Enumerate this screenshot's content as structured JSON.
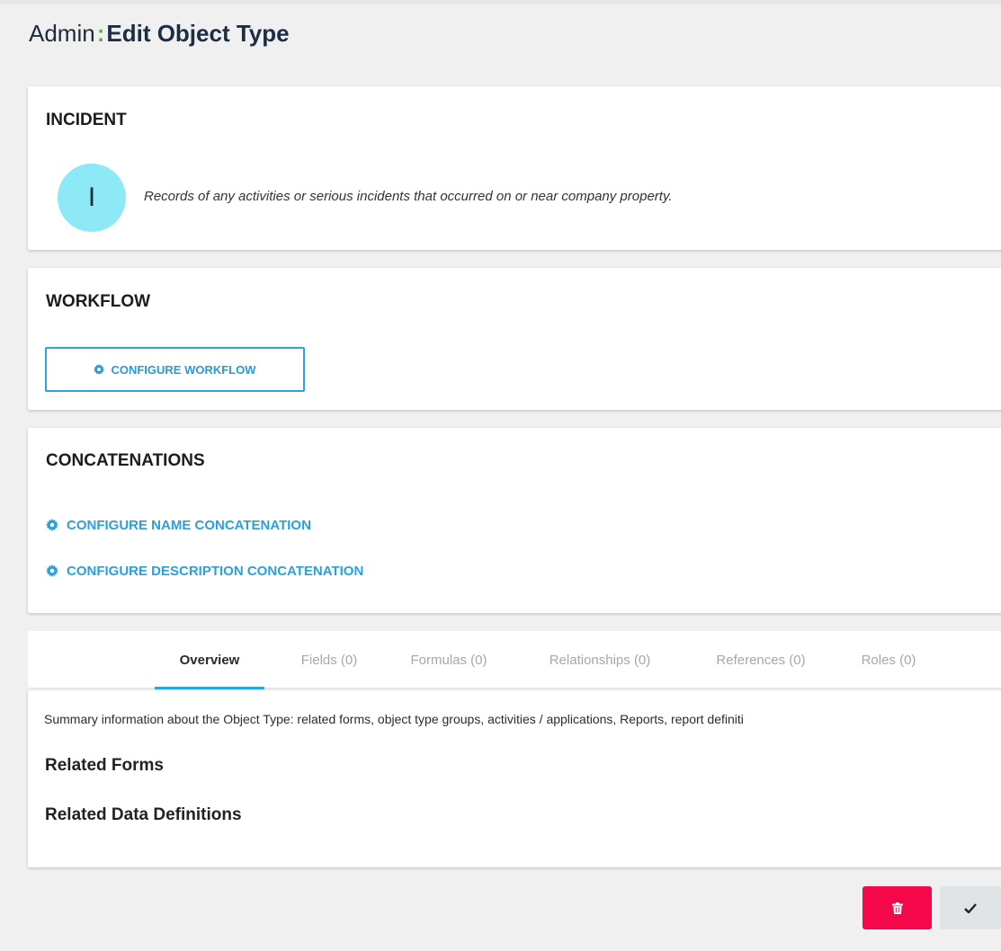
{
  "header": {
    "prefix": "Admin",
    "separator": ":",
    "title": "Edit Object Type"
  },
  "incident": {
    "title": "INCIDENT",
    "avatar_letter": "I",
    "description": "Records of any activities or serious incidents that occurred on or near company property."
  },
  "workflow": {
    "title": "WORKFLOW",
    "configure_label": "CONFIGURE WORKFLOW"
  },
  "concatenations": {
    "title": "CONCATENATIONS",
    "name_link": "CONFIGURE NAME CONCATENATION",
    "description_link": "CONFIGURE DESCRIPTION CONCATENATION"
  },
  "tabs": [
    {
      "label": "Overview",
      "active": true
    },
    {
      "label": "Fields (0)",
      "active": false
    },
    {
      "label": "Formulas (0)",
      "active": false
    },
    {
      "label": "Relationships (0)",
      "active": false
    },
    {
      "label": "References (0)",
      "active": false
    },
    {
      "label": "Roles (0)",
      "active": false
    }
  ],
  "overview": {
    "summary": "Summary information about the Object Type: related forms, object type groups, activities / applications, Reports, report definiti",
    "related_forms": "Related Forms",
    "related_data_definitions": "Related Data Definitions"
  },
  "actions": {
    "delete_icon": "trash-icon",
    "save_icon": "check-icon"
  },
  "colors": {
    "accent": "#2aa7e0",
    "separator_green": "#5fb548",
    "avatar_bg": "#8de9f6",
    "delete_red": "#f5084a"
  }
}
